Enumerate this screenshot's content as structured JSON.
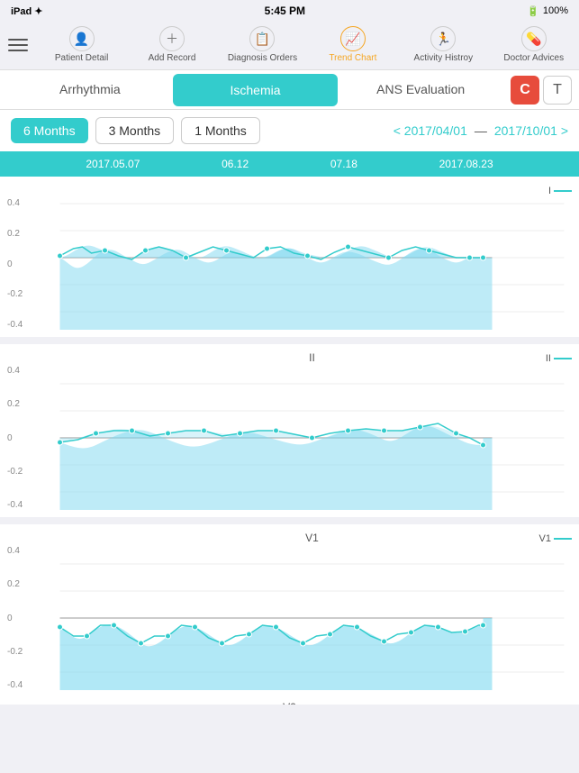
{
  "statusBar": {
    "left": "iPad ✦",
    "time": "5:45 PM",
    "battery": "100%",
    "wifi": "✦"
  },
  "navBar": {
    "items": [
      {
        "id": "patient-detail",
        "label": "Patient Detail",
        "icon": "👤",
        "active": false
      },
      {
        "id": "add-record",
        "label": "Add Record",
        "icon": "➕",
        "active": false
      },
      {
        "id": "diagnosis-orders",
        "label": "Diagnosis Orders",
        "icon": "📋",
        "active": false
      },
      {
        "id": "trend-chart",
        "label": "Trend Chart",
        "icon": "📈",
        "active": true
      },
      {
        "id": "activity-history",
        "label": "Activity Histroy",
        "icon": "🏃",
        "active": false
      },
      {
        "id": "doctor-advices",
        "label": "Doctor Advices",
        "icon": "💊",
        "active": false
      }
    ]
  },
  "tabs": [
    {
      "id": "arrhythmia",
      "label": "Arrhythmia",
      "active": false
    },
    {
      "id": "ischemia",
      "label": "Ischemia",
      "active": true
    },
    {
      "id": "ans-evaluation",
      "label": "ANS Evaluation",
      "active": false
    }
  ],
  "avatars": {
    "c": "C",
    "t": "T"
  },
  "periodButtons": [
    {
      "id": "6months",
      "label": "6 Months",
      "active": true
    },
    {
      "id": "3months",
      "label": "3 Months",
      "active": false
    },
    {
      "id": "1month",
      "label": "1 Months",
      "active": false
    }
  ],
  "dateRange": {
    "prev": "< 2017/04/01",
    "dash": "—",
    "next": "2017/10/01 >"
  },
  "timelineLabels": [
    "2017.05.07",
    "06.12",
    "07.18",
    "2017.08.23"
  ],
  "charts": [
    {
      "id": "chart-I",
      "title": "",
      "legend": "I",
      "yAxis": [
        "0.4",
        "0.2",
        "0",
        "-0.2",
        "-0.4"
      ]
    },
    {
      "id": "chart-II",
      "title": "II",
      "legend": "II",
      "yAxis": [
        "0.4",
        "0.2",
        "0",
        "-0.2",
        "-0.4"
      ]
    },
    {
      "id": "chart-V1",
      "title": "V1",
      "legend": "V1",
      "yAxis": [
        "0.4",
        "0.2",
        "0",
        "-0.2",
        "-0.4"
      ]
    }
  ]
}
